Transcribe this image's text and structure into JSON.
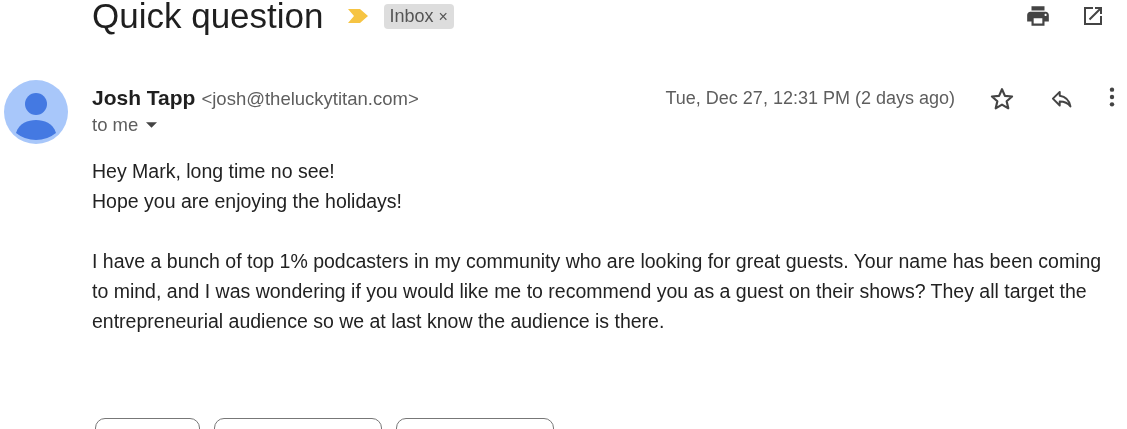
{
  "subject": "Quick question",
  "label": {
    "text": "Inbox",
    "close": "×"
  },
  "sender": {
    "name": "Josh Tapp",
    "email": "<josh@theluckytitan.com>",
    "recipient": "to me",
    "date": "Tue, Dec 27, 12:31 PM (2 days ago)",
    "starred": false
  },
  "body": [
    [
      "Hey Mark, long time no see!",
      "Hope you are enjoying the holidays!"
    ],
    [
      "I have a bunch of top 1% podcasters in my community who are looking for great guests. Your name has been coming to mind, and I was wondering if you would like me to recommend you as a guest on their shows? They all target the entrepreneurial audience so we at last know the audience is there."
    ]
  ]
}
